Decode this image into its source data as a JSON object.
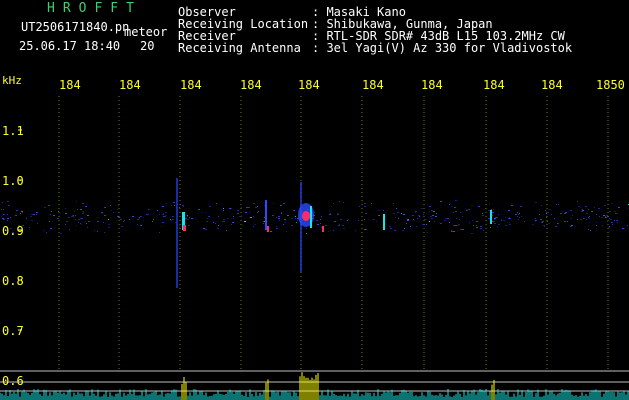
{
  "header": {
    "brand": "HROFFT",
    "filename": "UT2506171840.pn",
    "mode": "meteor",
    "datetime": "25.06.17 18:40",
    "count": "20"
  },
  "info": [
    {
      "label": "Observer",
      "value": ": Masaki Kano"
    },
    {
      "label": "Receiving Location",
      "value": ": Shibukawa, Gunma, Japan"
    },
    {
      "label": "Receiver",
      "value": ": RTL-SDR SDR# 43dB L15 103.2MHz CW"
    },
    {
      "label": "Receiving Antenna",
      "value": ": 3el Yagi(V) Az 330 for Vladivostok"
    }
  ],
  "axis": {
    "unit": "kHz",
    "top_ticks": [
      "184",
      "184",
      "184",
      "184",
      "184",
      "184",
      "184",
      "184",
      "184",
      "1850"
    ],
    "y_ticks": [
      "1.1",
      "1.0",
      "0.9",
      "0.8",
      "0.7",
      "0.6"
    ]
  },
  "colors": {
    "background": "#000000",
    "text_green": "#3fd06a",
    "text_yellow": "#ffff2a",
    "signal_blue": "#2a4cff",
    "signal_cyan": "#19e6e6",
    "signal_red": "#ff2a6a",
    "meteor_yellow": "#ffff00"
  }
}
